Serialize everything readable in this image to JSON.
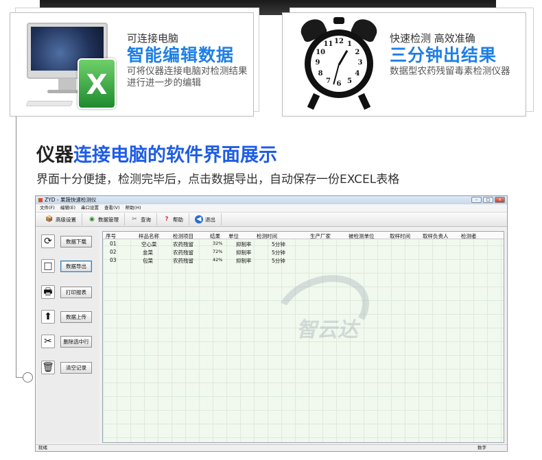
{
  "card1": {
    "subtitle": "可连接电脑",
    "main": "智能编辑数据",
    "desc": "可将仪器连接电脑对检测结果进行进一步的编辑",
    "excel_glyph": "X"
  },
  "card2": {
    "subtitle": "快速检测  高效准确",
    "main": "三分钟出结果",
    "desc": "数据型农药残留毒素检测仪器",
    "clock_numbers": [
      "12",
      "1",
      "2",
      "3",
      "4",
      "5",
      "6",
      "7",
      "8",
      "9",
      "10",
      "11"
    ]
  },
  "heading": {
    "black": "仪器",
    "blue": "连接电脑的软件界面展示"
  },
  "subheading": "界面十分便捷，检测完毕后，点击数据导出，自动保存一份EXCEL表格",
  "window": {
    "title": "ZYD - 果蔬快速检测仪",
    "controls": {
      "min": "–",
      "max": "□",
      "close": "×"
    },
    "menu": [
      "文件(F)",
      "编辑(E)",
      "串口设置",
      "查看(V)",
      "帮助(H)"
    ],
    "toolbar": [
      {
        "label": "高级设置",
        "icon": "📦"
      },
      {
        "label": "数据管理",
        "icon": "◉"
      },
      {
        "label": "查询",
        "icon": "✂"
      },
      {
        "label": "帮助",
        "icon": "?"
      },
      {
        "label": "退出",
        "icon": "◀"
      }
    ],
    "side_buttons": [
      {
        "label": "数据下载",
        "icon": "⟳"
      },
      {
        "label": "数据导出",
        "icon": "□"
      },
      {
        "label": "打印报表",
        "icon": "🖶"
      },
      {
        "label": "数据上传",
        "icon": "⬆"
      },
      {
        "label": "删除选中行",
        "icon": "✂"
      },
      {
        "label": "清空记录",
        "icon": "🗑"
      }
    ],
    "columns": [
      "序号",
      "样品名称",
      "检测项目",
      "结果",
      "单位",
      "检测时间",
      "生产厂家",
      "被检测单位",
      "取样时间",
      "取样负责人",
      "检测者"
    ],
    "rows": [
      {
        "no": "01",
        "name": "空心菜",
        "item": "农药残留",
        "result": "32%",
        "unit": "抑制率",
        "time": "5分钟"
      },
      {
        "no": "02",
        "name": "韭菜",
        "item": "农药残留",
        "result": "72%",
        "unit": "抑制率",
        "time": "5分钟"
      },
      {
        "no": "03",
        "name": "包菜",
        "item": "农药残留",
        "result": "42%",
        "unit": "抑制率",
        "time": "5分钟"
      }
    ],
    "watermark": "智云达",
    "status_left": "就绪",
    "status_right": "数字"
  },
  "colors": {
    "accent_blue": "#1e7fe6",
    "heading_blue": "#1e5ce6"
  }
}
